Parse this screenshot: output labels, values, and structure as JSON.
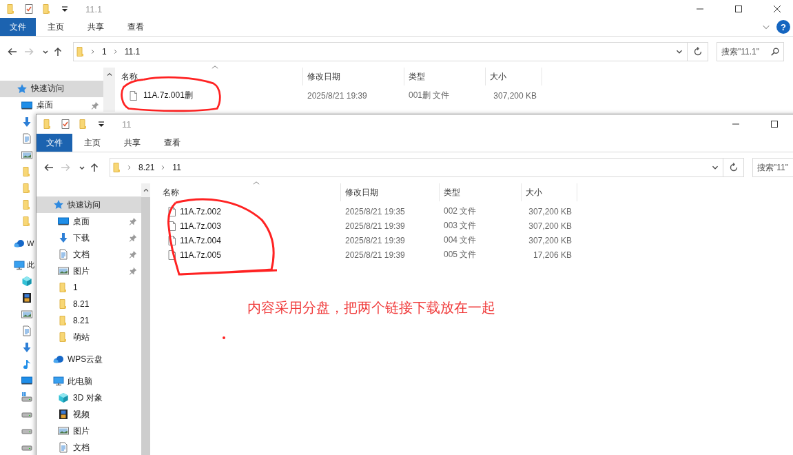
{
  "windows": [
    {
      "title": "11.1",
      "help": {
        "label": "?"
      },
      "ribbon_tabs": [
        {
          "label": "文件",
          "selected": true
        },
        {
          "label": "主页",
          "selected": false
        },
        {
          "label": "共享",
          "selected": false
        },
        {
          "label": "查看",
          "selected": false
        }
      ],
      "nav": [
        {
          "kind": "back",
          "disabled": false
        },
        {
          "kind": "forward",
          "disabled": true
        },
        {
          "kind": "recent",
          "disabled": false
        },
        {
          "kind": "up",
          "disabled": false
        }
      ],
      "path": [
        "1",
        "11.1"
      ],
      "search": {
        "placeholder": "搜索\"11.1\""
      },
      "sidebar": [
        {
          "kind": "star",
          "label": "快速访问",
          "selected": true,
          "pinned": false,
          "children": [
            {
              "kind": "desktop",
              "label": "桌面",
              "selected": false,
              "pinned": true
            },
            {
              "kind": "download",
              "selected": false
            },
            {
              "kind": "document",
              "selected": false
            },
            {
              "kind": "picture",
              "selected": false
            },
            {
              "kind": "folder",
              "selected": false
            },
            {
              "kind": "folder",
              "selected": false
            },
            {
              "kind": "folder",
              "selected": false
            },
            {
              "kind": "folder",
              "selected": false
            }
          ]
        },
        {
          "kind": "cloud",
          "label": "W",
          "selected": false
        },
        {
          "kind": "pc",
          "label": "此",
          "selected": false,
          "children": [
            {
              "kind": "cube",
              "selected": false
            },
            {
              "kind": "video",
              "selected": false
            },
            {
              "kind": "picture",
              "selected": false
            },
            {
              "kind": "document",
              "selected": false
            },
            {
              "kind": "download",
              "selected": false
            },
            {
              "kind": "music",
              "selected": false
            },
            {
              "kind": "desktop",
              "selected": false
            },
            {
              "kind": "drive_win",
              "selected": false
            },
            {
              "kind": "drive",
              "selected": false
            },
            {
              "kind": "drive",
              "selected": false
            },
            {
              "kind": "drive",
              "selected": false
            }
          ]
        }
      ],
      "columns": [
        "名称",
        "修改日期",
        "类型",
        "大小"
      ],
      "files": [
        {
          "name": "11A.7z.001删",
          "date": "2025/8/21 19:39",
          "type": "001删 文件",
          "size": "307,200 KB"
        }
      ]
    },
    {
      "title": "11",
      "ribbon_tabs": [
        {
          "label": "文件",
          "selected": true
        },
        {
          "label": "主页",
          "selected": false
        },
        {
          "label": "共享",
          "selected": false
        },
        {
          "label": "查看",
          "selected": false
        }
      ],
      "nav": [
        {
          "kind": "back",
          "disabled": false
        },
        {
          "kind": "forward",
          "disabled": true
        },
        {
          "kind": "recent",
          "disabled": false
        },
        {
          "kind": "up",
          "disabled": false
        }
      ],
      "path": [
        "8.21",
        "11"
      ],
      "search": {
        "placeholder": "搜索\"11\""
      },
      "sidebar": [
        {
          "kind": "star",
          "label": "快速访问",
          "selected": true,
          "pinned": false,
          "children": [
            {
              "kind": "desktop",
              "label": "桌面",
              "selected": false,
              "pinned": true
            },
            {
              "kind": "download",
              "label": "下载",
              "selected": false,
              "pinned": true
            },
            {
              "kind": "document",
              "label": "文档",
              "selected": false,
              "pinned": true
            },
            {
              "kind": "picture",
              "label": "图片",
              "selected": false,
              "pinned": true
            },
            {
              "kind": "folder",
              "label": "1",
              "selected": false,
              "pinned": false
            },
            {
              "kind": "folder",
              "label": "8.21",
              "selected": false,
              "pinned": false
            },
            {
              "kind": "folder",
              "label": "8.21",
              "selected": false,
              "pinned": false
            },
            {
              "kind": "folder",
              "label": "萌站",
              "selected": false,
              "pinned": false
            }
          ]
        },
        {
          "kind": "cloud",
          "label": "WPS云盘",
          "selected": false,
          "pinned": false
        },
        {
          "kind": "pc",
          "label": "此电脑",
          "selected": false,
          "pinned": false,
          "children": [
            {
              "kind": "cube",
              "label": "3D 对象",
              "selected": false,
              "pinned": false
            },
            {
              "kind": "video",
              "label": "视频",
              "selected": false,
              "pinned": false
            },
            {
              "kind": "picture",
              "label": "图片",
              "selected": false,
              "pinned": false
            },
            {
              "kind": "document",
              "label": "文档",
              "selected": false,
              "pinned": false
            }
          ]
        }
      ],
      "columns": [
        "名称",
        "修改日期",
        "类型",
        "大小"
      ],
      "files": [
        {
          "name": "11A.7z.002",
          "date": "2025/8/21 19:35",
          "type": "002 文件",
          "size": "307,200 KB"
        },
        {
          "name": "11A.7z.003",
          "date": "2025/8/21 19:39",
          "type": "003 文件",
          "size": "307,200 KB"
        },
        {
          "name": "11A.7z.004",
          "date": "2025/8/21 19:39",
          "type": "004 文件",
          "size": "307,200 KB"
        },
        {
          "name": "11A.7z.005",
          "date": "2025/8/21 19:39",
          "type": "005 文件",
          "size": "17,206 KB"
        }
      ],
      "annotation": {
        "note": "内容采用分盘，把两个链接下载放在一起"
      }
    }
  ]
}
